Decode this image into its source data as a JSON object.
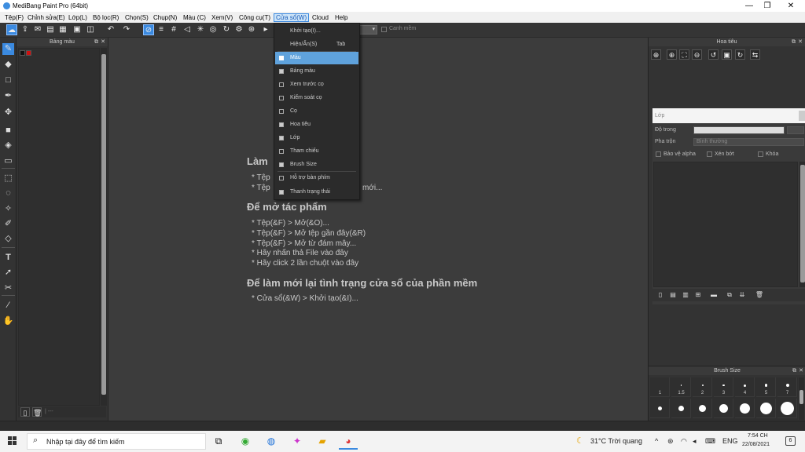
{
  "window": {
    "title": "MediBang Paint Pro (64bit)",
    "minimize": "—",
    "maximize": "❐",
    "close": "✕"
  },
  "menu": [
    {
      "label": "Tệp(F)"
    },
    {
      "label": "Chỉnh sửa(E)"
    },
    {
      "label": "Lớp(L)"
    },
    {
      "label": "Bộ lọc(R)"
    },
    {
      "label": "Chọn(S)"
    },
    {
      "label": "Chụp(N)"
    },
    {
      "label": "Màu (C)"
    },
    {
      "label": "Xem(V)"
    },
    {
      "label": "Công cụ(T)"
    },
    {
      "label": "Cửa sổ(W)"
    },
    {
      "label": "Cloud"
    },
    {
      "label": "Help"
    }
  ],
  "toolbar": {
    "smooth_label": "Canh mềm"
  },
  "palette_panel": {
    "title": "Bảng màu",
    "swatch_colors": [
      "#111111",
      "#cc1111"
    ],
    "footer_text": "| ---"
  },
  "canvas_help": {
    "section1_heading": "Làm",
    "section1_line1": "* Tệp",
    "section1_line2": "* Tệp",
    "section1_line2_tail": "mới...",
    "section2_heading": "Để mở tác phẩm",
    "section2_lines": [
      "* Tệp(&F) > Mở(&O)...",
      "* Tệp(&F) > Mở tệp gần đây(&R)",
      "* Tệp(&F) > Mở từ đám mây...",
      "* Hãy nhấn thả File vào đây",
      "* Hãy click 2 lần chuột vào đây"
    ],
    "section3_heading": "Để làm mới lại tình trạng cửa sổ của phần mềm",
    "section3_lines": [
      "* Cửa sổ(&W) > Khởi tạo(&I)..."
    ]
  },
  "dropdown_menu": {
    "items": [
      {
        "label": "Khởi tạo(I)...",
        "shortcut": "",
        "check": "none",
        "highlighted": false
      },
      {
        "label": "Hiện/Ẩn(S)",
        "shortcut": "Tab",
        "check": "none",
        "highlighted": false
      },
      {
        "label": "Màu",
        "shortcut": "",
        "check": "on",
        "highlighted": true
      },
      {
        "label": "Bảng màu",
        "shortcut": "",
        "check": "on",
        "highlighted": false
      },
      {
        "label": "Xem trước cọ",
        "shortcut": "",
        "check": "off",
        "highlighted": false
      },
      {
        "label": "Kiểm soát cọ",
        "shortcut": "",
        "check": "off",
        "highlighted": false
      },
      {
        "label": "Cọ",
        "shortcut": "",
        "check": "off",
        "highlighted": false
      },
      {
        "label": "Hoa tiêu",
        "shortcut": "",
        "check": "on",
        "highlighted": false
      },
      {
        "label": "Lớp",
        "shortcut": "",
        "check": "on",
        "highlighted": false
      },
      {
        "label": "Tham chiếu",
        "shortcut": "",
        "check": "off",
        "highlighted": false
      },
      {
        "label": "Brush Size",
        "shortcut": "",
        "check": "on",
        "highlighted": false
      },
      {
        "label": "Hỗ trợ bàn phím",
        "shortcut": "",
        "check": "off",
        "highlighted": false
      },
      {
        "label": "Thanh trạng thái",
        "shortcut": "",
        "check": "on",
        "highlighted": false
      }
    ]
  },
  "navigator_panel": {
    "title": "Hoa tiêu"
  },
  "layer_panel": {
    "title": "Lớp",
    "opacity_label": "Độ trong",
    "blend_label": "Pha trộn",
    "blend_value": "Bình thường",
    "protect_alpha": "Bảo vệ alpha",
    "clipping": "Xén bớt",
    "lock": "Khóa"
  },
  "brush_size_panel": {
    "title": "Brush Size",
    "sizes": [
      "1",
      "1.5",
      "2",
      "3",
      "4",
      "5",
      "7"
    ]
  },
  "taskbar": {
    "search_placeholder": "Nhập tại đây để tìm kiếm",
    "weather": "31°C  Trời quang",
    "language": "ENG",
    "time": "7:54 CH",
    "date": "22/08/2021",
    "notifications": "6"
  },
  "colors": {
    "accent": "#3b8ae0",
    "menu_highlight": "#5fa2dc"
  }
}
